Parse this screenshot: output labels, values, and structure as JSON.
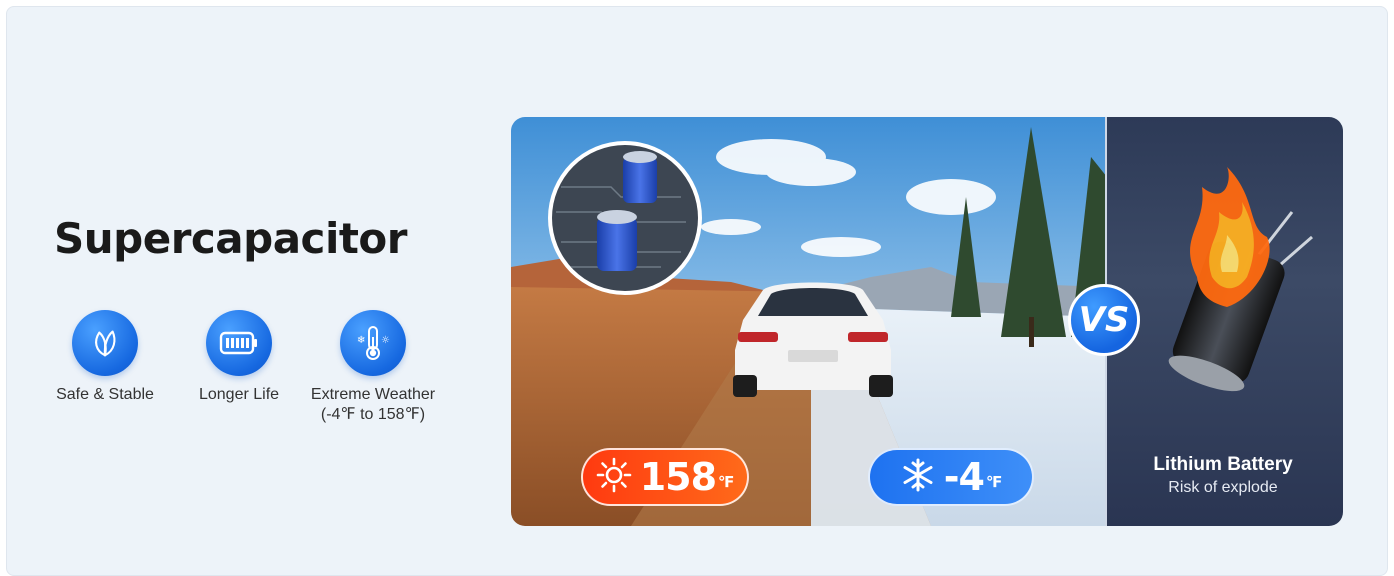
{
  "heading": "Supercapacitor",
  "features": [
    {
      "icon": "leaf-icon",
      "label": "Safe & Stable"
    },
    {
      "icon": "battery-icon",
      "label": "Longer Life"
    },
    {
      "icon": "thermometer-icon",
      "label": "Extreme Weather",
      "sublabel": "(-4℉ to 158℉)"
    }
  ],
  "hot_badge": {
    "icon": "sun-icon",
    "value": "158",
    "unit": "℉"
  },
  "cold_badge": {
    "icon": "snowflake-icon",
    "value": "-4",
    "unit": "℉"
  },
  "vs_label": "VS",
  "lithium": {
    "title": "Lithium Battery",
    "subtitle": "Risk of explode"
  },
  "colors": {
    "accent_blue": "#1668e0",
    "hot": "#ff4a14",
    "panel_dark": "#2f3c59"
  }
}
